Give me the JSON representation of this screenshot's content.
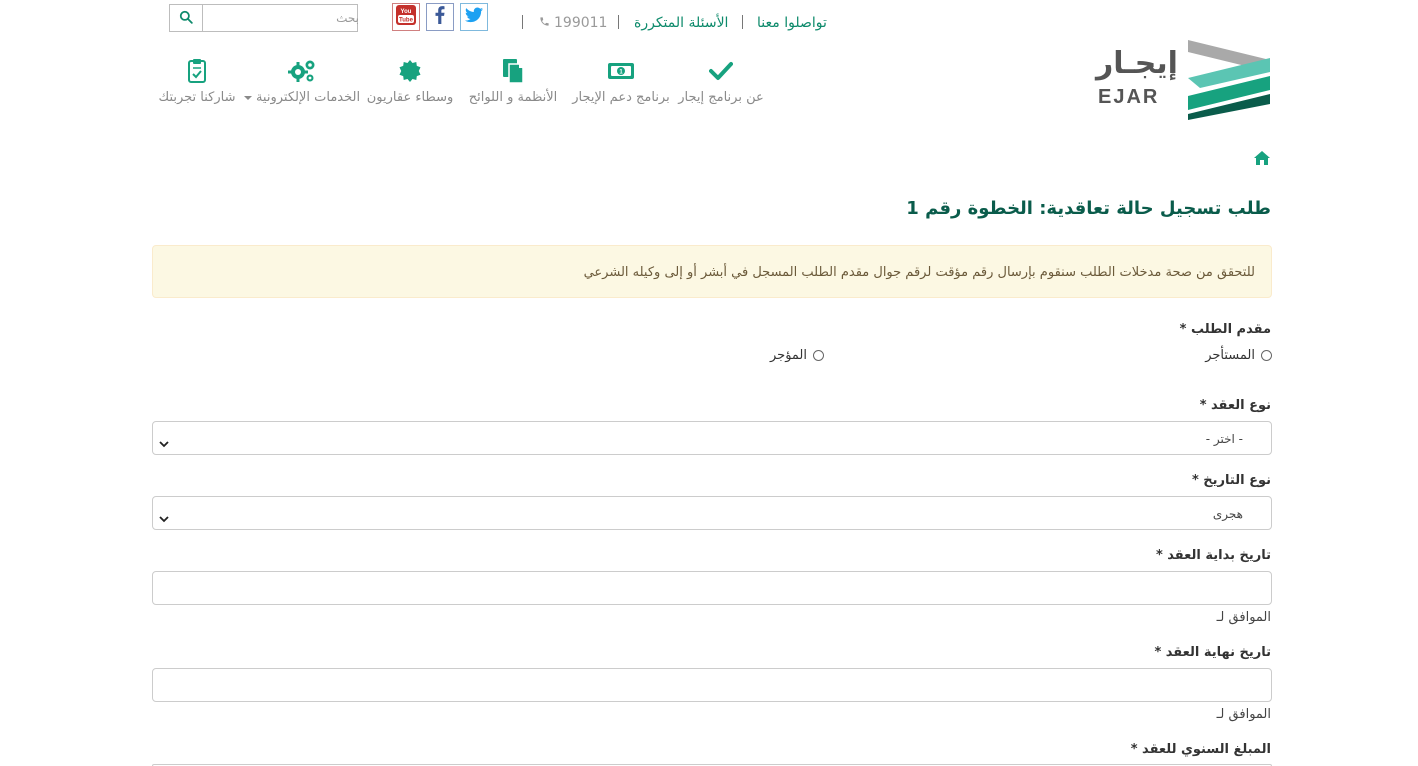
{
  "header": {
    "links": {
      "contact": "تواصلوا معنا",
      "faq": "الأسئلة المتكررة",
      "phone": "199011"
    },
    "social": [
      {
        "name": "twitter",
        "label": "",
        "icon": "twitter-icon"
      },
      {
        "name": "facebook",
        "label": "",
        "icon": "facebook-icon"
      },
      {
        "name": "youtube",
        "label": "YouTube",
        "icon": "youtube-icon"
      }
    ],
    "search": {
      "placeholder": "بحث",
      "icon": "search-icon"
    },
    "logo": {
      "arabic": "إيجـار",
      "latin": "EJAR"
    }
  },
  "nav": [
    {
      "label": "عن برنامج إيجار",
      "icon": "checkmark-icon"
    },
    {
      "label": "برنامج دعم الإيجار",
      "icon": "money-icon"
    },
    {
      "label": "الأنظمة و اللوائح",
      "icon": "documents-icon"
    },
    {
      "label": "وسطاء عقاريون",
      "icon": "badge-icon"
    },
    {
      "label": "الخدمات الإلكترونية",
      "icon": "gears-icon",
      "has_dropdown": true
    },
    {
      "label": "شاركنا تجربتك",
      "icon": "clipboard-icon"
    }
  ],
  "breadcrumb": {
    "icon": "home-icon"
  },
  "page": {
    "title": "طلب تسجيل حالة تعاقدية: الخطوة رقم 1",
    "alert": "للتحقق من صحة مدخلات الطلب سنقوم بإرسال رقم مؤقت لرقم جوال مقدم الطلب المسجل في أبشر أو إلى وكيله الشرعي"
  },
  "form": {
    "applicant": {
      "label": "مقدم الطلب *",
      "options": [
        "المستأجر",
        "المؤجر"
      ]
    },
    "contract_type": {
      "label": "نوع العقد *",
      "value": "- اختر -"
    },
    "date_type": {
      "label": "نوع التاريخ *",
      "value": "هجرى"
    },
    "start_date": {
      "label": "تاريخ بداية العقد *",
      "value": "",
      "hint": "الموافق لـ"
    },
    "end_date": {
      "label": "تاريخ نهاية العقد *",
      "value": "",
      "hint": "الموافق لـ"
    },
    "annual_amount": {
      "label": "المبلغ السنوي للعقد *"
    }
  },
  "colors": {
    "brand": "#0d8a6b",
    "brand_dark": "#0a5c4b",
    "alert_bg": "#fcf8e3",
    "twitter": "#1da1f2",
    "facebook": "#3b5998",
    "youtube": "#c4302b"
  }
}
